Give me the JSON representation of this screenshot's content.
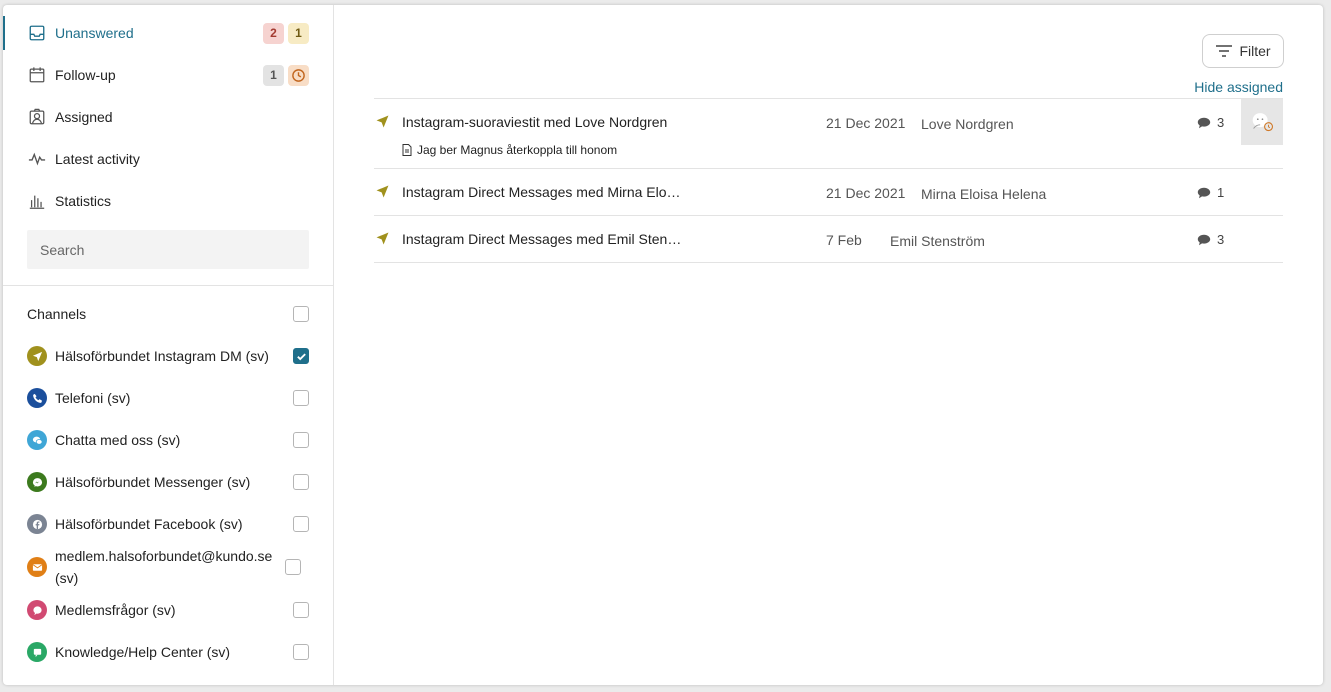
{
  "nav": {
    "items": [
      {
        "label": "Unanswered",
        "icon": "inbox-icon",
        "badges": [
          "2",
          "1"
        ],
        "active": true
      },
      {
        "label": "Follow-up",
        "icon": "calendar-icon",
        "badges": [
          "1"
        ]
      },
      {
        "label": "Assigned",
        "icon": "assigned-user-icon"
      },
      {
        "label": "Latest activity",
        "icon": "activity-icon"
      },
      {
        "label": "Statistics",
        "icon": "bar-chart-icon"
      }
    ]
  },
  "search": {
    "placeholder": "Search",
    "value": ""
  },
  "channels": {
    "header": "Channels",
    "items": [
      {
        "label": "Hälsoförbundet Instagram DM (sv)",
        "icon": "instagram-dm-icon",
        "color": "#a0911d",
        "checked": true
      },
      {
        "label": "Telefoni (sv)",
        "icon": "phone-icon",
        "color": "#1b4f9c",
        "checked": false
      },
      {
        "label": "Chatta med oss (sv)",
        "icon": "chat-icon",
        "color": "#3fa6d6",
        "checked": false
      },
      {
        "label": "Hälsoförbundet Messenger (sv)",
        "icon": "messenger-icon",
        "color": "#3c7a1e",
        "checked": false
      },
      {
        "label": "Hälsoförbundet Facebook (sv)",
        "icon": "facebook-icon",
        "color": "#7b8493",
        "checked": false
      },
      {
        "label": "medlem.halsoforbundet@kundo.se (sv)",
        "icon": "email-icon",
        "color": "#e07f16",
        "checked": false
      },
      {
        "label": "Medlemsfrågor (sv)",
        "icon": "question-bubble-icon",
        "color": "#d14a72",
        "checked": false
      },
      {
        "label": "Knowledge/Help Center (sv)",
        "icon": "help-center-icon",
        "color": "#2aa866",
        "checked": false
      }
    ]
  },
  "toolbar": {
    "filter_label": "Filter",
    "hide_assigned_label": "Hide assigned"
  },
  "conversations": [
    {
      "subject": "Instagram-suoraviestit med Love Nordgren",
      "note": "Jag ber Magnus återkoppla till honom",
      "date": "21 Dec 2021",
      "name": "Love Nordgren",
      "count": "3",
      "has_avatar": true
    },
    {
      "subject": "Instagram Direct Messages med Mirna Elo…",
      "date": "21 Dec 2021",
      "name": "Mirna Eloisa Helena",
      "count": "1"
    },
    {
      "subject": "Instagram Direct Messages med Emil Sten…",
      "date": "7 Feb",
      "name": "Emil Stenström",
      "count": "3"
    }
  ],
  "colors": {
    "accent": "#1f6f8b",
    "instagram_dm": "#a0911d"
  }
}
